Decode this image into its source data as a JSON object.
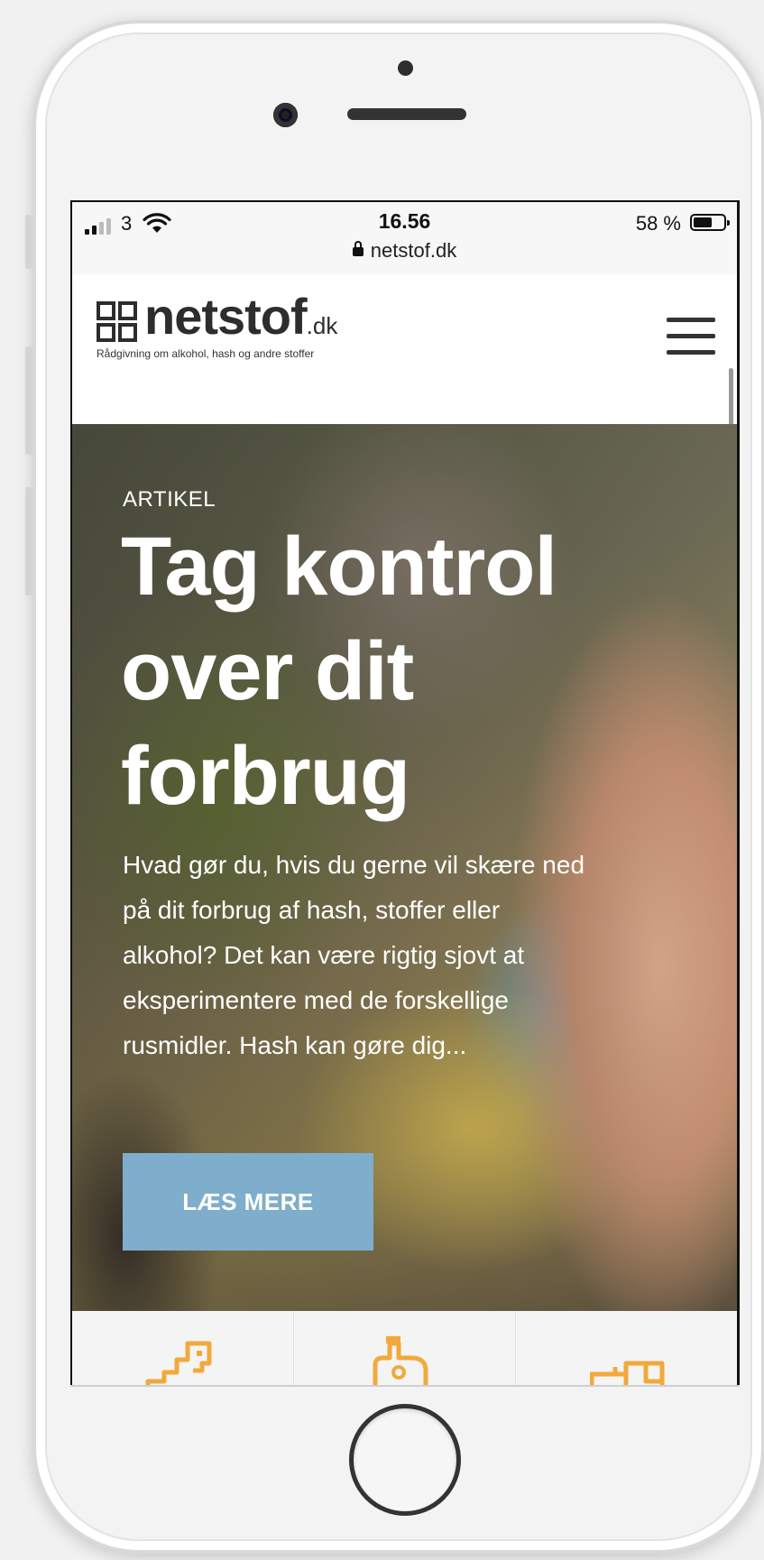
{
  "status_bar": {
    "carrier": "3",
    "time": "16.56",
    "battery": "58 %",
    "url": "netstof.dk"
  },
  "site": {
    "logo_name": "netstof",
    "logo_suffix": ".dk",
    "tagline": "Rådgivning om alkohol, hash og andre stoffer"
  },
  "hero": {
    "kicker": "ARTIKEL",
    "title": "Tag kontrol over dit forbrug",
    "body": "Hvad gør du, hvis du gerne vil skære ned på dit forbrug af hash, stoffer eller alkohol? Det kan være rigtig sjovt at eksperimentere med de forskellige rusmidler. Hash kan gøre dig...",
    "button_label": "LÆS MERE"
  },
  "icons": {
    "tiles": [
      "head-profile-icon",
      "person-with-bottle-icon",
      "boxes-icon"
    ],
    "accent": "#f2a93b"
  },
  "colors": {
    "button": "#7eaecb",
    "hero_text": "#ffffff",
    "logo": "#2d2d2d"
  }
}
